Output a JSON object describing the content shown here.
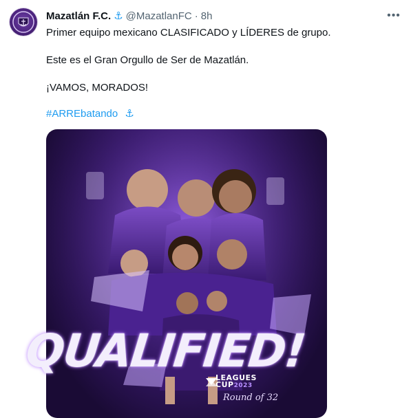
{
  "tweet": {
    "author_name": "Mazatlán F.C.",
    "verified_icon": "anchor-icon",
    "handle": "@MazatlanFC",
    "separator": "·",
    "time": "8h",
    "more_icon": "more-options-icon",
    "more_label": "•••",
    "lines": [
      "Primer equipo mexicano CLASIFICADO y LÍDERES de grupo.",
      "Este es el Gran Orgullo de Ser de Mazatlán.",
      "¡VAMOS, MORADOS!"
    ],
    "hashtag": "#ARREbatando",
    "hashtag_icon": "anchor-icon"
  },
  "media": {
    "headline": "QUALIFIED!",
    "brand_line1": "LEAGUES",
    "brand_line2": "CUP",
    "brand_year": "2023",
    "round_text": "Round of 32"
  },
  "colors": {
    "link": "#1d9bf0",
    "secondary_text": "#536471",
    "primary_text": "#0f1419",
    "brand_purple": "#4b237c"
  }
}
